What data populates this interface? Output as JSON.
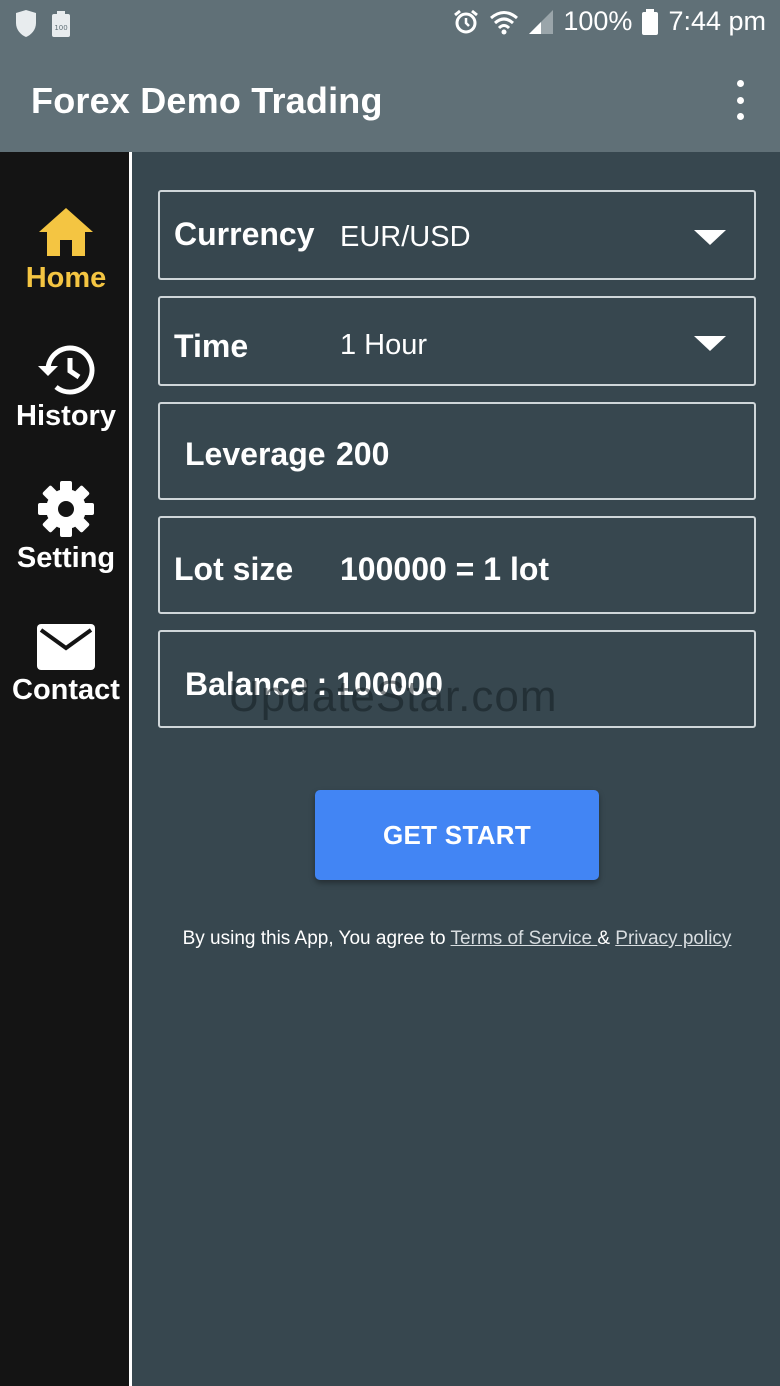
{
  "status_bar": {
    "battery_percent": "100%",
    "time": "7:44 pm",
    "icons": [
      "shield-icon",
      "battery-saver-icon",
      "alarm-icon",
      "wifi-icon",
      "signal-icon",
      "battery-icon"
    ]
  },
  "app_bar": {
    "title": "Forex Demo Trading",
    "menu_icon": "more-vert-icon"
  },
  "sidebar": {
    "items": [
      {
        "label": "Home",
        "icon": "home-icon",
        "active": true
      },
      {
        "label": "History",
        "icon": "history-icon",
        "active": false
      },
      {
        "label": "Setting",
        "icon": "gear-icon",
        "active": false
      },
      {
        "label": "Contact",
        "icon": "mail-icon",
        "active": false
      }
    ]
  },
  "form": {
    "currency": {
      "label": "Currency",
      "value": "EUR/USD"
    },
    "time": {
      "label": "Time",
      "value": "1 Hour"
    },
    "leverage": {
      "label": "Leverage",
      "value": "200"
    },
    "lot_size": {
      "label": "Lot size",
      "value": "100000 = 1 lot"
    },
    "balance": {
      "label": "Balance : 100000"
    }
  },
  "start_button": {
    "label": "GET START"
  },
  "terms": {
    "prefix": "By using this App, You agree to ",
    "tos_link": "Terms of Service ",
    "amp": "& ",
    "privacy_link": "Privacy policy"
  },
  "watermark": "UpdateStar.com",
  "colors": {
    "app_bar": "#607077",
    "background": "#37474f",
    "sidebar": "#141414",
    "active": "#f4c542",
    "button": "#4285f4"
  }
}
